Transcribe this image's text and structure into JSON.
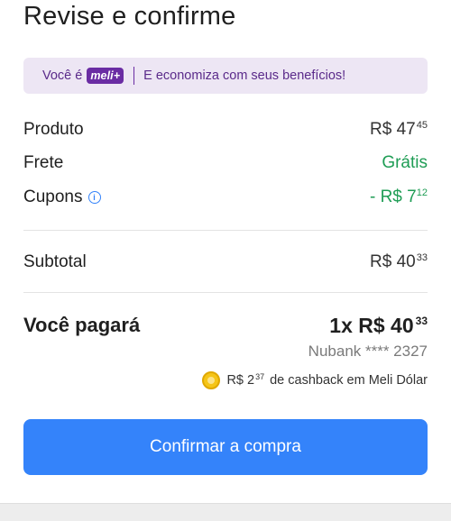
{
  "page": {
    "title": "Revise e confirme"
  },
  "banner": {
    "prefix": "Você é",
    "badge": "meli+",
    "message": "E economiza com seus benefícios!"
  },
  "summary": {
    "produto": {
      "label": "Produto",
      "currency": "R$",
      "int": "47",
      "cents": "45"
    },
    "frete": {
      "label": "Frete",
      "value": "Grátis"
    },
    "cupons": {
      "label": "Cupons",
      "info_icon": "i",
      "prefix": "- R$",
      "int": "7",
      "cents": "12"
    },
    "subtotal": {
      "label": "Subtotal",
      "currency": "R$",
      "int": "40",
      "cents": "33"
    }
  },
  "payment": {
    "label": "Você pagará",
    "installments": "1x R$",
    "int": "40",
    "cents": "33",
    "card": "Nubank **** 2327",
    "cashback": {
      "currency": "R$",
      "int": "2",
      "cents": "37",
      "text": "de cashback em Meli Dólar"
    }
  },
  "actions": {
    "confirm_label": "Confirmar a compra"
  },
  "colors": {
    "accent": "#3483fa",
    "green": "#1f9d55",
    "meli_purple": "#6a2ca3",
    "banner_bg": "#ede6f4"
  },
  "icons": {
    "info": "info-icon",
    "coin": "meli-dolar-coin-icon"
  }
}
